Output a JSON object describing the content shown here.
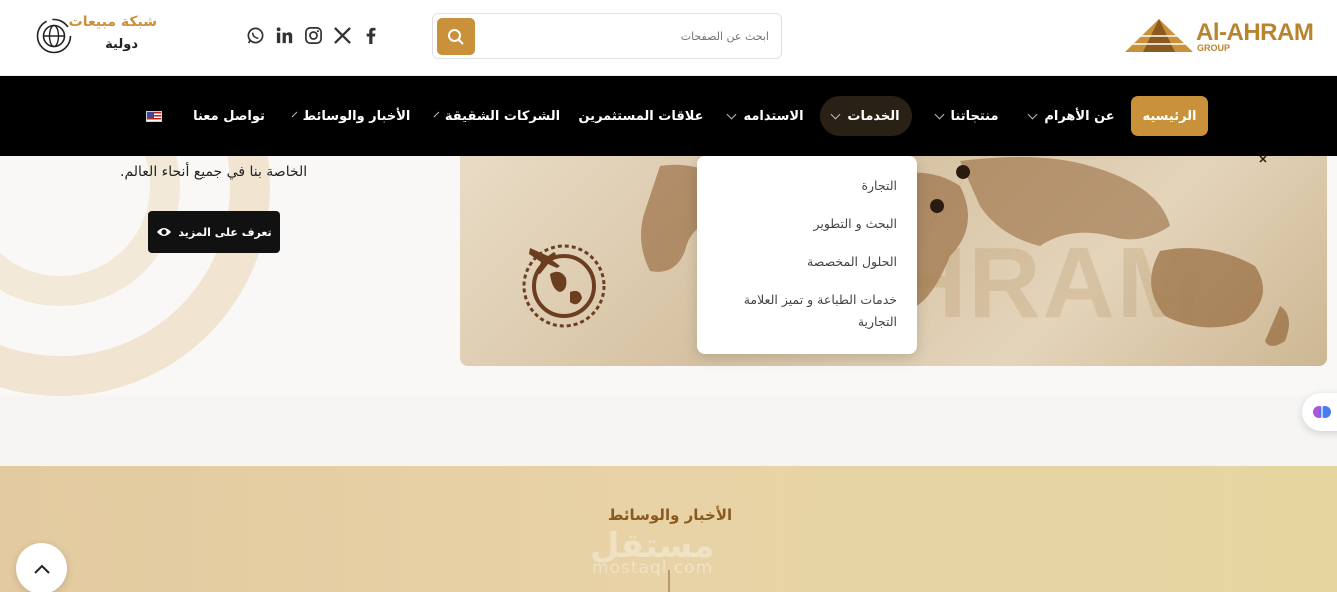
{
  "header": {
    "logo": {
      "brand": "Al-AHRAM",
      "sub": "GROUP"
    },
    "search": {
      "placeholder": "ابحث عن الصفحات"
    },
    "sales_network": {
      "line1": "شبكة مبيعات",
      "line2": "دولية"
    },
    "social": [
      "facebook-icon",
      "x-icon",
      "instagram-icon",
      "linkedin-icon",
      "whatsapp-icon"
    ]
  },
  "nav": {
    "items": [
      {
        "label": "الرئيسيه",
        "dropdown": false,
        "active": true
      },
      {
        "label": "عن الأهرام",
        "dropdown": true
      },
      {
        "label": "منتجاتنا",
        "dropdown": true
      },
      {
        "label": "الخدمات",
        "dropdown": true,
        "hover": true
      },
      {
        "label": "الاستدامه",
        "dropdown": true
      },
      {
        "label": "علاقات المستثمرين",
        "dropdown": false
      },
      {
        "label": "الشركات الشقيقة",
        "dropdown": true
      },
      {
        "label": "الأخبار والوسائط",
        "dropdown": true
      },
      {
        "label": "تواصل معنا",
        "dropdown": false
      }
    ]
  },
  "services_menu": {
    "items": [
      "التجارة",
      "البحث و التطوير",
      "الحلول المخصصة",
      "خدمات الطباعة و تميز العلامة التجارية"
    ]
  },
  "hero": {
    "text": "الخاصة بنا في جميع أنحاء العالم.",
    "button": "تعرف على المزيد"
  },
  "band": {
    "title": "الأخبار والوسائط",
    "watermark": "مستقل",
    "watermark_sub": "mostaql.com"
  },
  "colors": {
    "accent": "#c9923a",
    "nav_bg": "#000000",
    "band": "#e6cfa2"
  }
}
